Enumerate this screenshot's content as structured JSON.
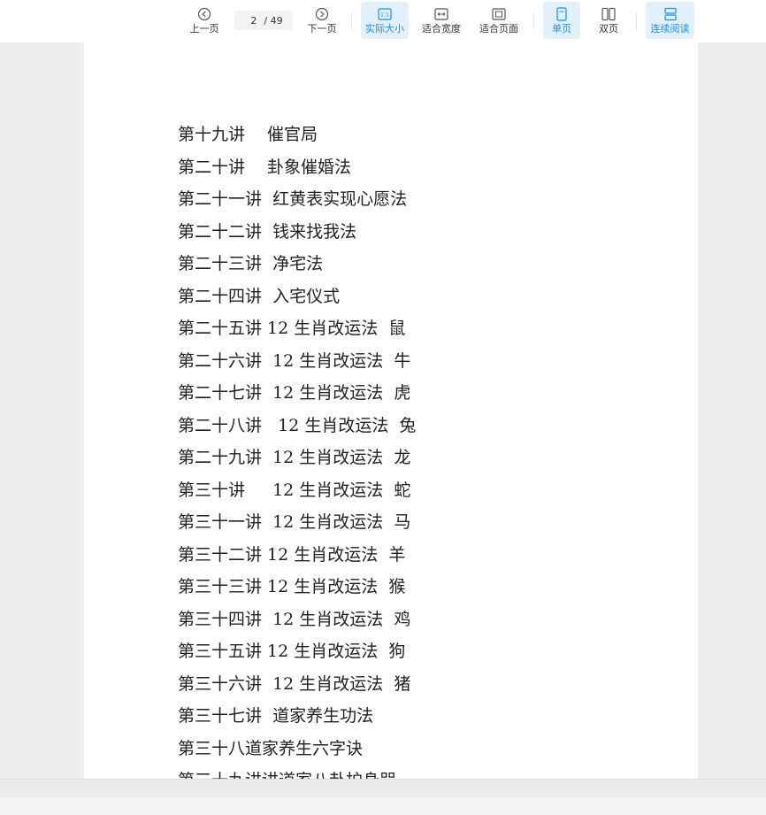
{
  "toolbar": {
    "prev_label": "上一页",
    "next_label": "下一页",
    "current_page": "2",
    "total_pages": "/ 49",
    "actual_size_label": "实际大小",
    "fit_width_label": "适合宽度",
    "fit_page_label": "适合页面",
    "single_page_label": "单页",
    "double_page_label": "双页",
    "continuous_label": "连续阅读",
    "accent_color": "#1a8fe8"
  },
  "document": {
    "toc_lines": [
      "第十九讲　 催官局",
      "第二十讲　 卦象催婚法",
      "第二十一讲  红黄表实现心愿法",
      "第二十二讲  钱来找我法",
      "第二十三讲  净宅法",
      "第二十四讲  入宅仪式",
      "第二十五讲 12 生肖改运法  鼠",
      "第二十六讲  12 生肖改运法  牛",
      "第二十七讲  12 生肖改运法  虎",
      "第二十八讲   12 生肖改运法  兔",
      "第二十九讲  12 生肖改运法  龙",
      "第三十讲　  12 生肖改运法  蛇",
      "第三十一讲  12 生肖改运法  马",
      "第三十二讲 12 生肖改运法  羊",
      "第三十三讲 12 生肖改运法  猴",
      "第三十四讲  12 生肖改运法  鸡",
      "第三十五讲 12 生肖改运法  狗",
      "第三十六讲  12 生肖改运法  猪",
      "第三十七讲  道家养生功法",
      "第三十八道家养生六字诀",
      "第三十九讲讲道家八卦护身咒"
    ]
  }
}
